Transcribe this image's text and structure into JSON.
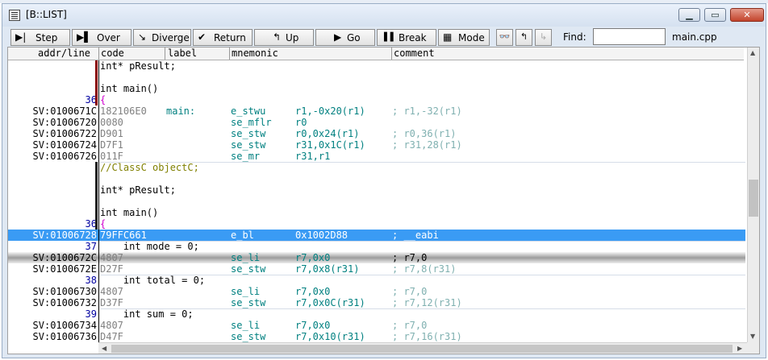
{
  "window": {
    "title": "[B::LIST]"
  },
  "toolbar": {
    "buttons": [
      {
        "label": "Step",
        "icon": "▶|"
      },
      {
        "label": "Over",
        "icon": "▶▌"
      },
      {
        "label": "Diverge",
        "icon": "↘"
      },
      {
        "label": "Return",
        "icon": "✔"
      },
      {
        "label": "Up",
        "icon": "↰"
      },
      {
        "label": "Go",
        "icon": "▶"
      },
      {
        "label": "Break",
        "icon": "▌▌"
      },
      {
        "label": "Mode",
        "icon": "▦"
      }
    ],
    "find_label": "Find:",
    "find_value": "",
    "file_name": "main.cpp"
  },
  "columns": {
    "addr": "addr/line",
    "code": "code",
    "label": "label",
    "mnemonic": "mnemonic",
    "comment": "comment"
  },
  "rows": [
    {
      "kind": "src",
      "src": "int* pResult;"
    },
    {
      "kind": "blank"
    },
    {
      "kind": "src",
      "src": "int main()"
    },
    {
      "kind": "srcline",
      "line": "36",
      "src": "{"
    },
    {
      "kind": "asm",
      "addr": "SV:0100671C",
      "code": "182106E0",
      "label": "main:",
      "mnemonic": "e_stwu",
      "operands": "r1,-0x20(r1)",
      "comment": "; r1,-32(r1)"
    },
    {
      "kind": "asm",
      "addr": "SV:01006720",
      "code": "0080",
      "label": "",
      "mnemonic": "se_mflr",
      "operands": "r0",
      "comment": ""
    },
    {
      "kind": "asm",
      "addr": "SV:01006722",
      "code": "D901",
      "label": "",
      "mnemonic": "se_stw",
      "operands": "r0,0x24(r1)",
      "comment": "; r0,36(r1)"
    },
    {
      "kind": "asm",
      "addr": "SV:01006724",
      "code": "D7F1",
      "label": "",
      "mnemonic": "se_stw",
      "operands": "r31,0x1C(r1)",
      "comment": "; r31,28(r1)"
    },
    {
      "kind": "asm",
      "addr": "SV:01006726",
      "code": "011F",
      "label": "",
      "mnemonic": "se_mr",
      "operands": "r31,r1",
      "comment": ""
    },
    {
      "kind": "comment",
      "src": "//ClassC objectC;"
    },
    {
      "kind": "blank"
    },
    {
      "kind": "src",
      "src": "int* pResult;"
    },
    {
      "kind": "blank"
    },
    {
      "kind": "src",
      "src": "int main()"
    },
    {
      "kind": "srcline",
      "line": "36",
      "src": "{"
    },
    {
      "kind": "asm",
      "state": "sel",
      "addr": "SV:01006728",
      "code": "79FFC661",
      "label": "",
      "mnemonic": "e_bl",
      "operands": "0x1002D88",
      "comment": "; __eabi"
    },
    {
      "kind": "srcline",
      "line": "37",
      "src": "    int mode = 0;"
    },
    {
      "kind": "asm",
      "state": "cur",
      "addr": "SV:0100672C",
      "code": "4807",
      "label": "",
      "mnemonic": "se_li",
      "operands": "r7,0x0",
      "comment": "; r7,0"
    },
    {
      "kind": "asm",
      "addr": "SV:0100672E",
      "code": "D27F",
      "label": "",
      "mnemonic": "se_stw",
      "operands": "r7,0x8(r31)",
      "comment": "; r7,8(r31)"
    },
    {
      "kind": "srcline",
      "line": "38",
      "src": "    int total = 0;"
    },
    {
      "kind": "asm",
      "addr": "SV:01006730",
      "code": "4807",
      "label": "",
      "mnemonic": "se_li",
      "operands": "r7,0x0",
      "comment": "; r7,0"
    },
    {
      "kind": "asm",
      "addr": "SV:01006732",
      "code": "D37F",
      "label": "",
      "mnemonic": "se_stw",
      "operands": "r7,0x0C(r31)",
      "comment": "; r7,12(r31)"
    },
    {
      "kind": "srcline",
      "line": "39",
      "src": "    int sum = 0;"
    },
    {
      "kind": "asm",
      "addr": "SV:01006734",
      "code": "4807",
      "label": "",
      "mnemonic": "se_li",
      "operands": "r7,0x0",
      "comment": "; r7,0"
    },
    {
      "kind": "asm",
      "addr": "SV:01006736",
      "code": "D47F",
      "label": "",
      "mnemonic": "se_stw",
      "operands": "r7,0x10(r31)",
      "comment": "; r7,16(r31)"
    }
  ],
  "colors": {
    "selection": "#3a9bf4",
    "mnemonic": "#008080",
    "line_number": "#0000a0",
    "brace": "#d000d0",
    "comment_src": "#808000",
    "breakpoint_bar": "#8b0000"
  }
}
